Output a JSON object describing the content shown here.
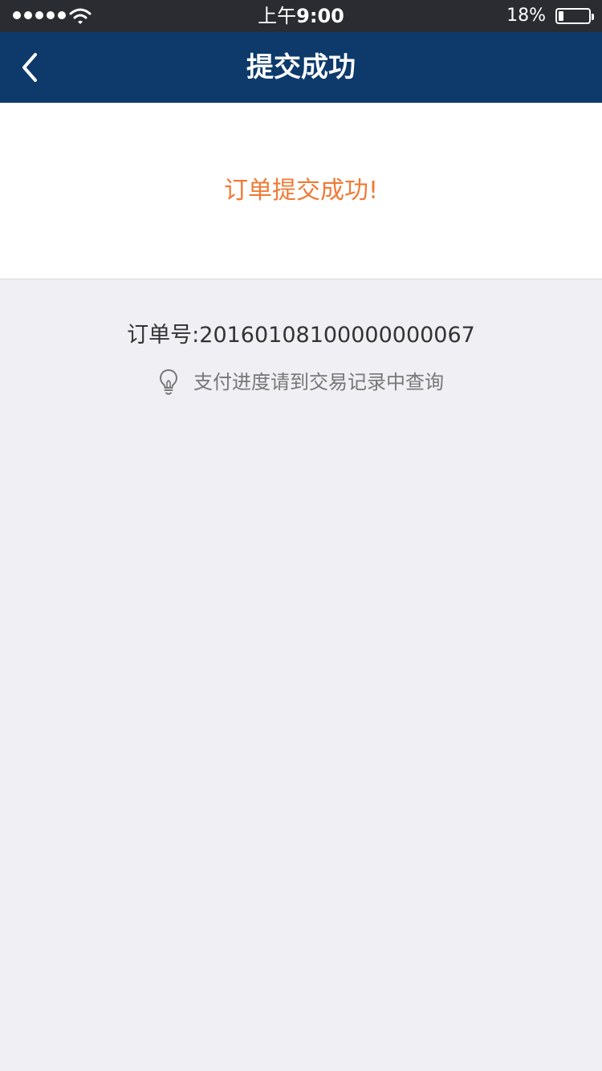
{
  "status_bar": {
    "time_prefix": "上午",
    "time": "9:00",
    "battery_percent_text": "18%",
    "battery_level": 0.18,
    "signal_icon": "signal-dots-icon",
    "wifi_icon": "wifi-icon",
    "battery_icon": "battery-icon"
  },
  "nav": {
    "title": "提交成功",
    "back_icon": "chevron-left-icon",
    "background_color": "#0d3a6b"
  },
  "result": {
    "message": "订单提交成功!",
    "message_color": "#f07a35"
  },
  "order": {
    "label": "订单号:",
    "number": "20160108100000000067"
  },
  "tip": {
    "icon": "lightbulb-icon",
    "text": "支付进度请到交易记录中查询"
  }
}
